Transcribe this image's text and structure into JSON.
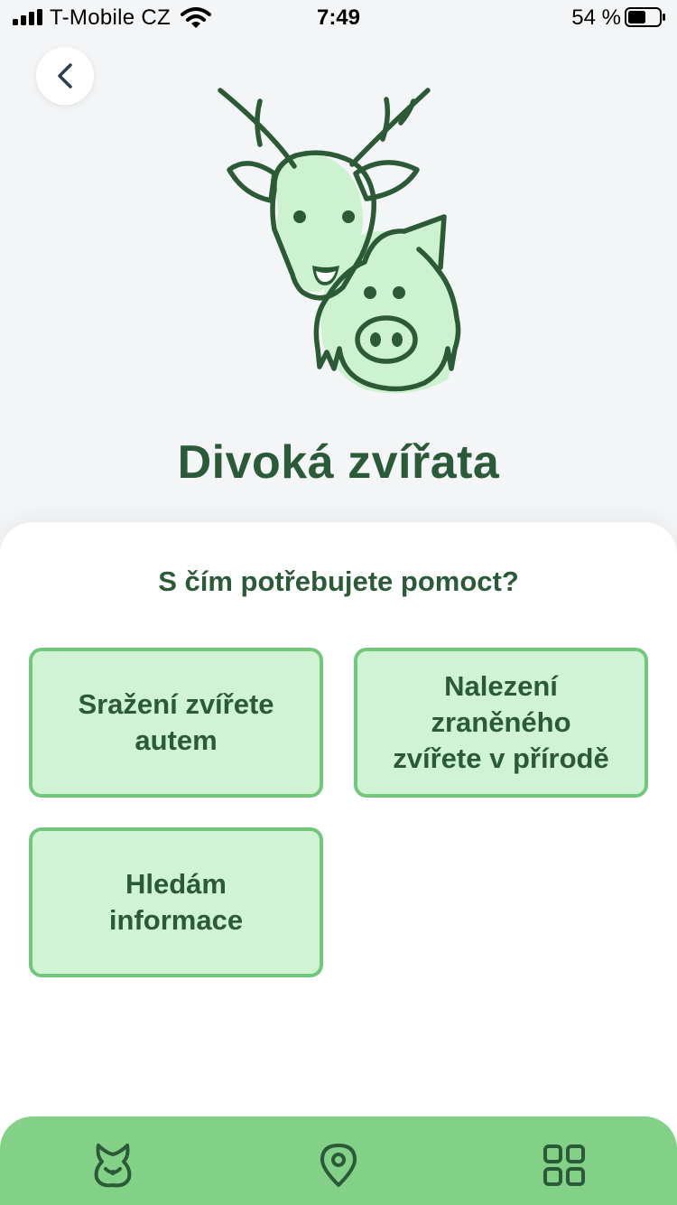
{
  "status_bar": {
    "carrier": "T-Mobile CZ",
    "time": "7:49",
    "battery": "54 %"
  },
  "header": {
    "title": "Divoká zvířata"
  },
  "card": {
    "question": "S čím potřebujete pomoct?",
    "options": [
      {
        "label": "Sražení zvířete\nautem"
      },
      {
        "label": "Nalezení\nzraněného\nzvířete v přírodě"
      },
      {
        "label": "Hledám\ninformace"
      }
    ]
  },
  "tab_bar": {
    "tabs": [
      {
        "icon": "animal-face-icon"
      },
      {
        "icon": "map-pin-icon"
      },
      {
        "icon": "grid-icon"
      }
    ]
  },
  "colors": {
    "primary_dark": "#2a5a37",
    "accent_green": "#82d186",
    "option_fill": "#cff3d3",
    "option_border": "#72c77c",
    "illustration_fill": "#cdf2d0"
  }
}
